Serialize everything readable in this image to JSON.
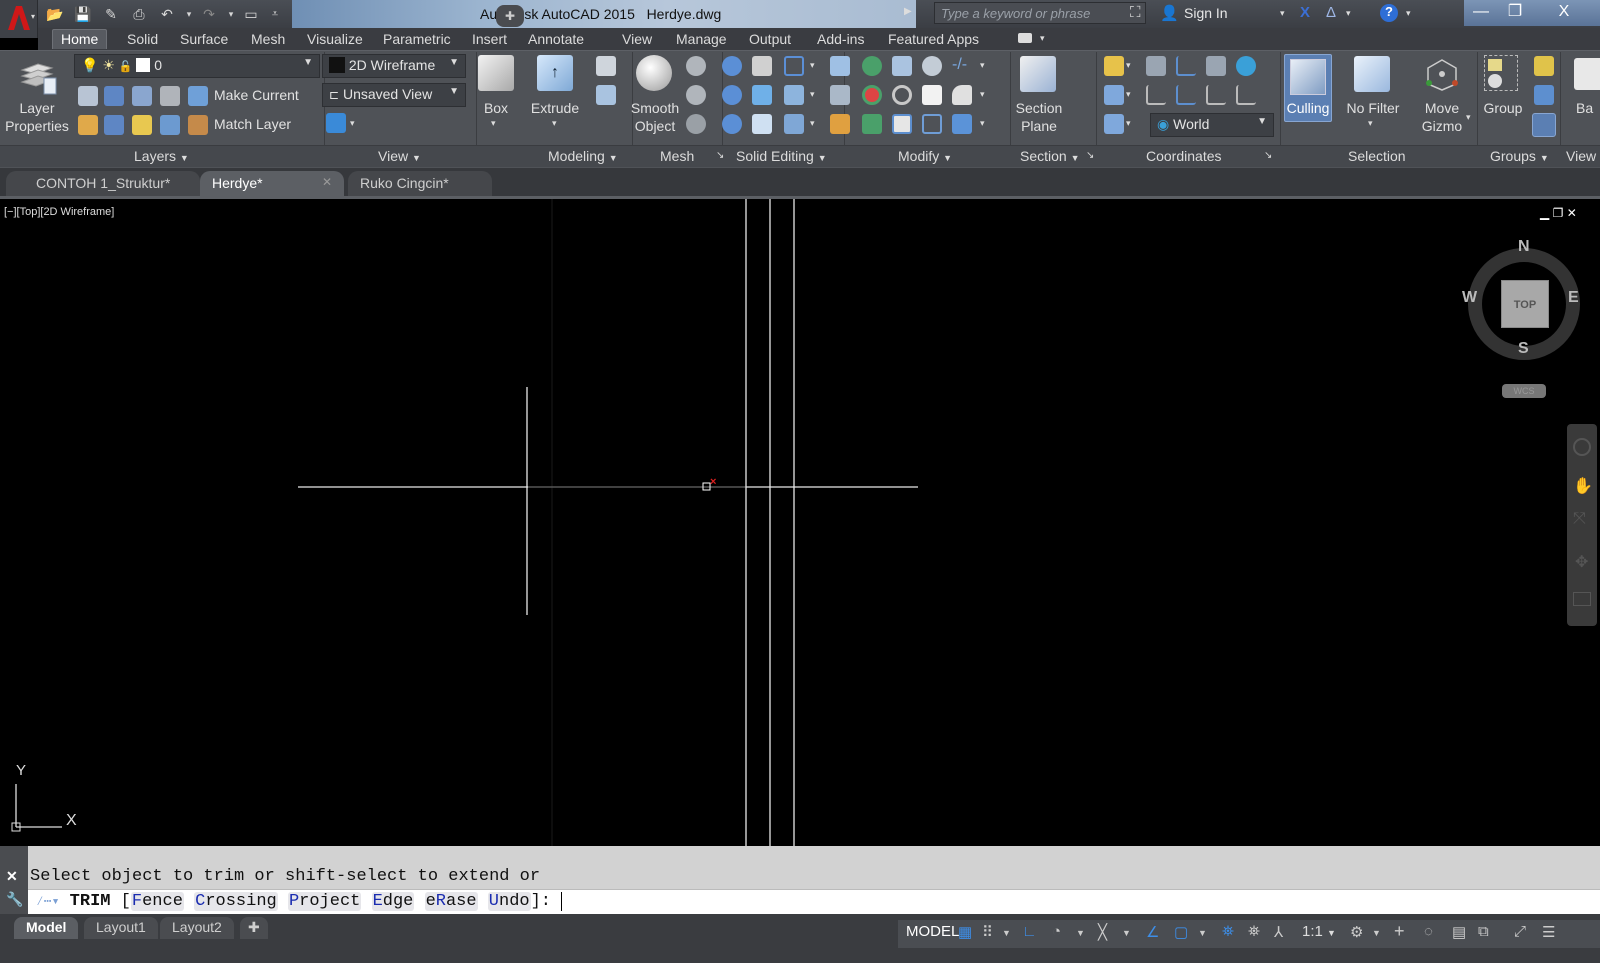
{
  "window": {
    "title": "Autodesk AutoCAD 2015",
    "filename": "Herdye.dwg",
    "search_placeholder": "Type a keyword or phrase",
    "sign_in": "Sign In",
    "controls": {
      "minimize": "—",
      "restore": "❐",
      "close": "X"
    }
  },
  "quick_access": [
    "open-icon",
    "save-icon",
    "save-as-icon",
    "plot-icon",
    "undo-icon",
    "redo-icon",
    "new-sheet-icon",
    "customize-icon"
  ],
  "ribbon_tabs": [
    {
      "label": "Home",
      "active": true
    },
    {
      "label": "Solid"
    },
    {
      "label": "Surface"
    },
    {
      "label": "Mesh"
    },
    {
      "label": "Visualize"
    },
    {
      "label": "Parametric"
    },
    {
      "label": "Insert"
    },
    {
      "label": "Annotate"
    },
    {
      "label": "View"
    },
    {
      "label": "Manage"
    },
    {
      "label": "Output"
    },
    {
      "label": "Add-ins"
    },
    {
      "label": "Featured Apps"
    }
  ],
  "ribbon": {
    "layers": {
      "title": "Layers",
      "layer_properties": [
        "Layer",
        "Properties"
      ],
      "current_layer": "0",
      "make_current": "Make Current",
      "match_layer": "Match Layer"
    },
    "view": {
      "title": "View",
      "visual_style": "2D Wireframe",
      "named_view": "Unsaved View"
    },
    "modeling": {
      "title": "Modeling",
      "box": "Box",
      "extrude": "Extrude"
    },
    "mesh": {
      "title": "Mesh",
      "smooth_object": [
        "Smooth",
        "Object"
      ]
    },
    "solid_editing": {
      "title": "Solid Editing"
    },
    "modify": {
      "title": "Modify"
    },
    "section": {
      "title": "Section",
      "section_plane": [
        "Section",
        "Plane"
      ]
    },
    "coordinates": {
      "title": "Coordinates",
      "ucs": "World"
    },
    "selection": {
      "title": "Selection",
      "culling": "Culling",
      "no_filter": "No Filter",
      "move_gizmo": [
        "Move",
        "Gizmo"
      ]
    },
    "groups": {
      "title": "Groups",
      "group": "Group"
    },
    "view2": {
      "title": "View",
      "base": "Ba"
    }
  },
  "file_tabs": [
    {
      "label": "CONTOH 1_Struktur*"
    },
    {
      "label": "Herdye*",
      "active": true
    },
    {
      "label": "Ruko Cingcin*"
    }
  ],
  "viewport": {
    "label": "[−][Top][2D Wireframe]",
    "viewcube": {
      "face": "TOP",
      "n": "N",
      "s": "S",
      "e": "E",
      "w": "W",
      "ucs": "WCS"
    },
    "ucs_icon": {
      "x": "X",
      "y": "Y"
    }
  },
  "command": {
    "history": "Select object to trim or shift-select to extend or",
    "command_name": "TRIM",
    "options": [
      {
        "key": "F",
        "rest": "ence"
      },
      {
        "key": "C",
        "rest": "rossing"
      },
      {
        "key": "P",
        "rest": "roject"
      },
      {
        "key": "E",
        "rest": "dge"
      },
      {
        "pre": "e",
        "key": "R",
        "rest": "ase"
      },
      {
        "key": "U",
        "rest": "ndo"
      }
    ],
    "suffix": "]:"
  },
  "layout_tabs": [
    {
      "label": "Model",
      "active": true
    },
    {
      "label": "Layout1"
    },
    {
      "label": "Layout2"
    }
  ],
  "status": {
    "model": "MODEL",
    "scale": "1:1"
  }
}
